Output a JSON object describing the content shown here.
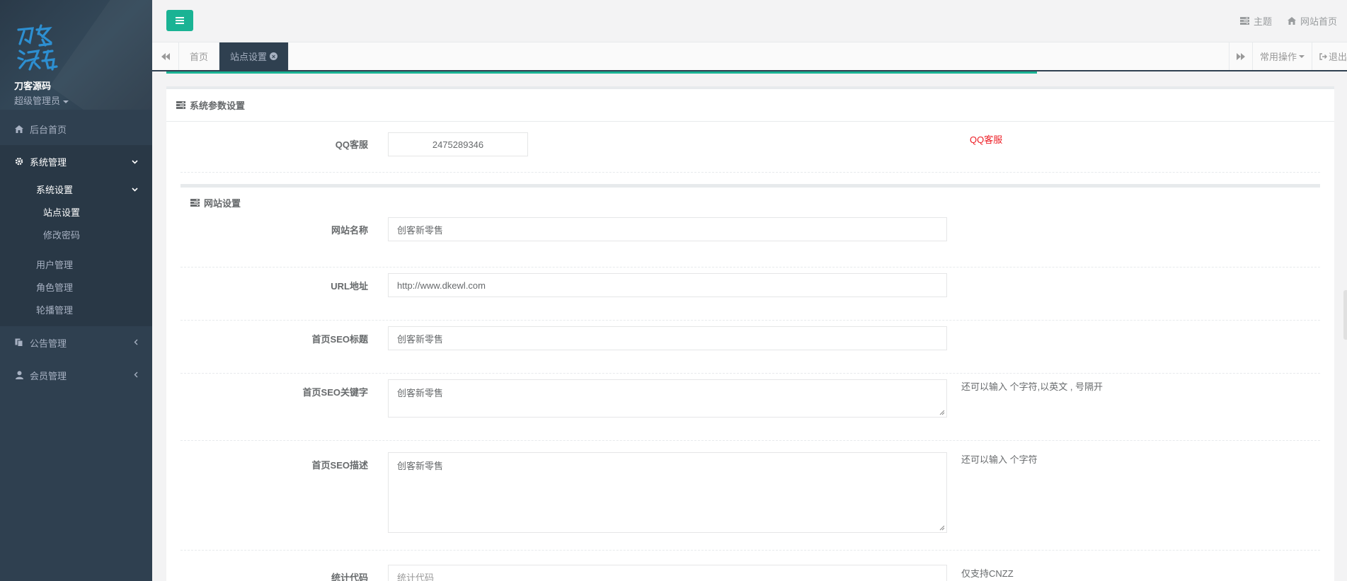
{
  "sidebar": {
    "brand_name": "刀客源码",
    "role": "超级管理员",
    "items": [
      {
        "label": "后台首页"
      },
      {
        "label": "系统管理"
      },
      {
        "label": "公告管理"
      },
      {
        "label": "会员管理"
      }
    ],
    "submenu": {
      "group_label": "系统设置",
      "group_items": [
        "站点设置",
        "修改密码"
      ],
      "items": [
        "用户管理",
        "角色管理",
        "轮播管理"
      ]
    }
  },
  "topbar": {
    "theme_label": "主题",
    "home_label": "网站首页"
  },
  "tabs": {
    "items": [
      "首页",
      "站点设置"
    ],
    "common_ops": "常用操作",
    "logout": "退出"
  },
  "system_params": {
    "title": "系统参数设置",
    "qq_label": "QQ客服",
    "qq_value": "2475289346",
    "qq_help": "QQ客服"
  },
  "site_settings": {
    "title": "网站设置",
    "site_name_label": "网站名称",
    "site_name_value": "创客新零售",
    "url_label": "URL地址",
    "url_value": "http://www.dkewl.com",
    "seo_title_label": "首页SEO标题",
    "seo_title_value": "创客新零售",
    "seo_keywords_label": "首页SEO关键字",
    "seo_keywords_value": "创客新零售",
    "seo_keywords_help": "还可以输入 个字符,以英文 , 号隔开",
    "seo_desc_label": "首页SEO描述",
    "seo_desc_value": "创客新零售",
    "seo_desc_help": "还可以输入 个字符",
    "stats_label": "统计代码",
    "stats_placeholder": "统计代码",
    "stats_help": "仅支持CNZZ"
  },
  "colors": {
    "sidebar_bg": "#2f4050",
    "accent": "#1ab394",
    "help_red": "#ed1c24"
  }
}
